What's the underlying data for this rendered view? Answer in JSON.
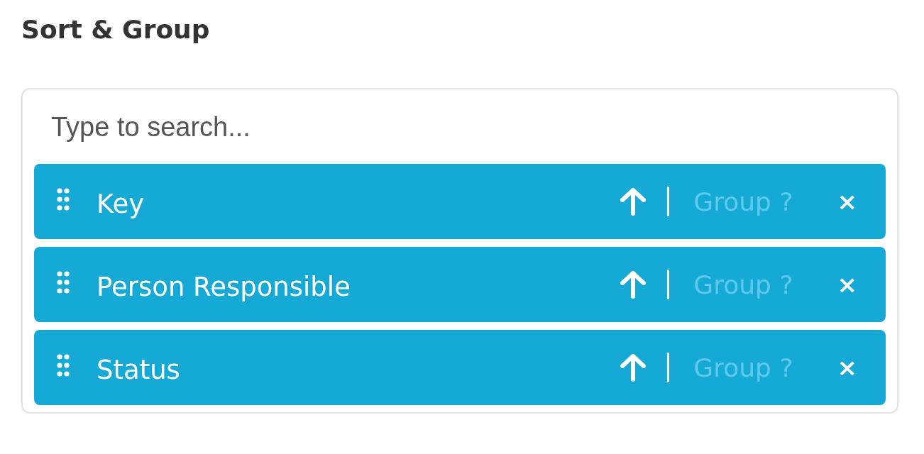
{
  "title": "Sort & Group",
  "search": {
    "placeholder": "Type to search..."
  },
  "fields": [
    {
      "name": "Key",
      "descending": false,
      "grouped": false,
      "group_label": "Group ?",
      "remove": "×"
    },
    {
      "name": "Person Responsible",
      "descending": false,
      "grouped": false,
      "group_label": "Group ?",
      "remove": "×"
    },
    {
      "name": "Status",
      "descending": false,
      "grouped": false,
      "group_label": "Group ?",
      "remove": "×"
    }
  ]
}
